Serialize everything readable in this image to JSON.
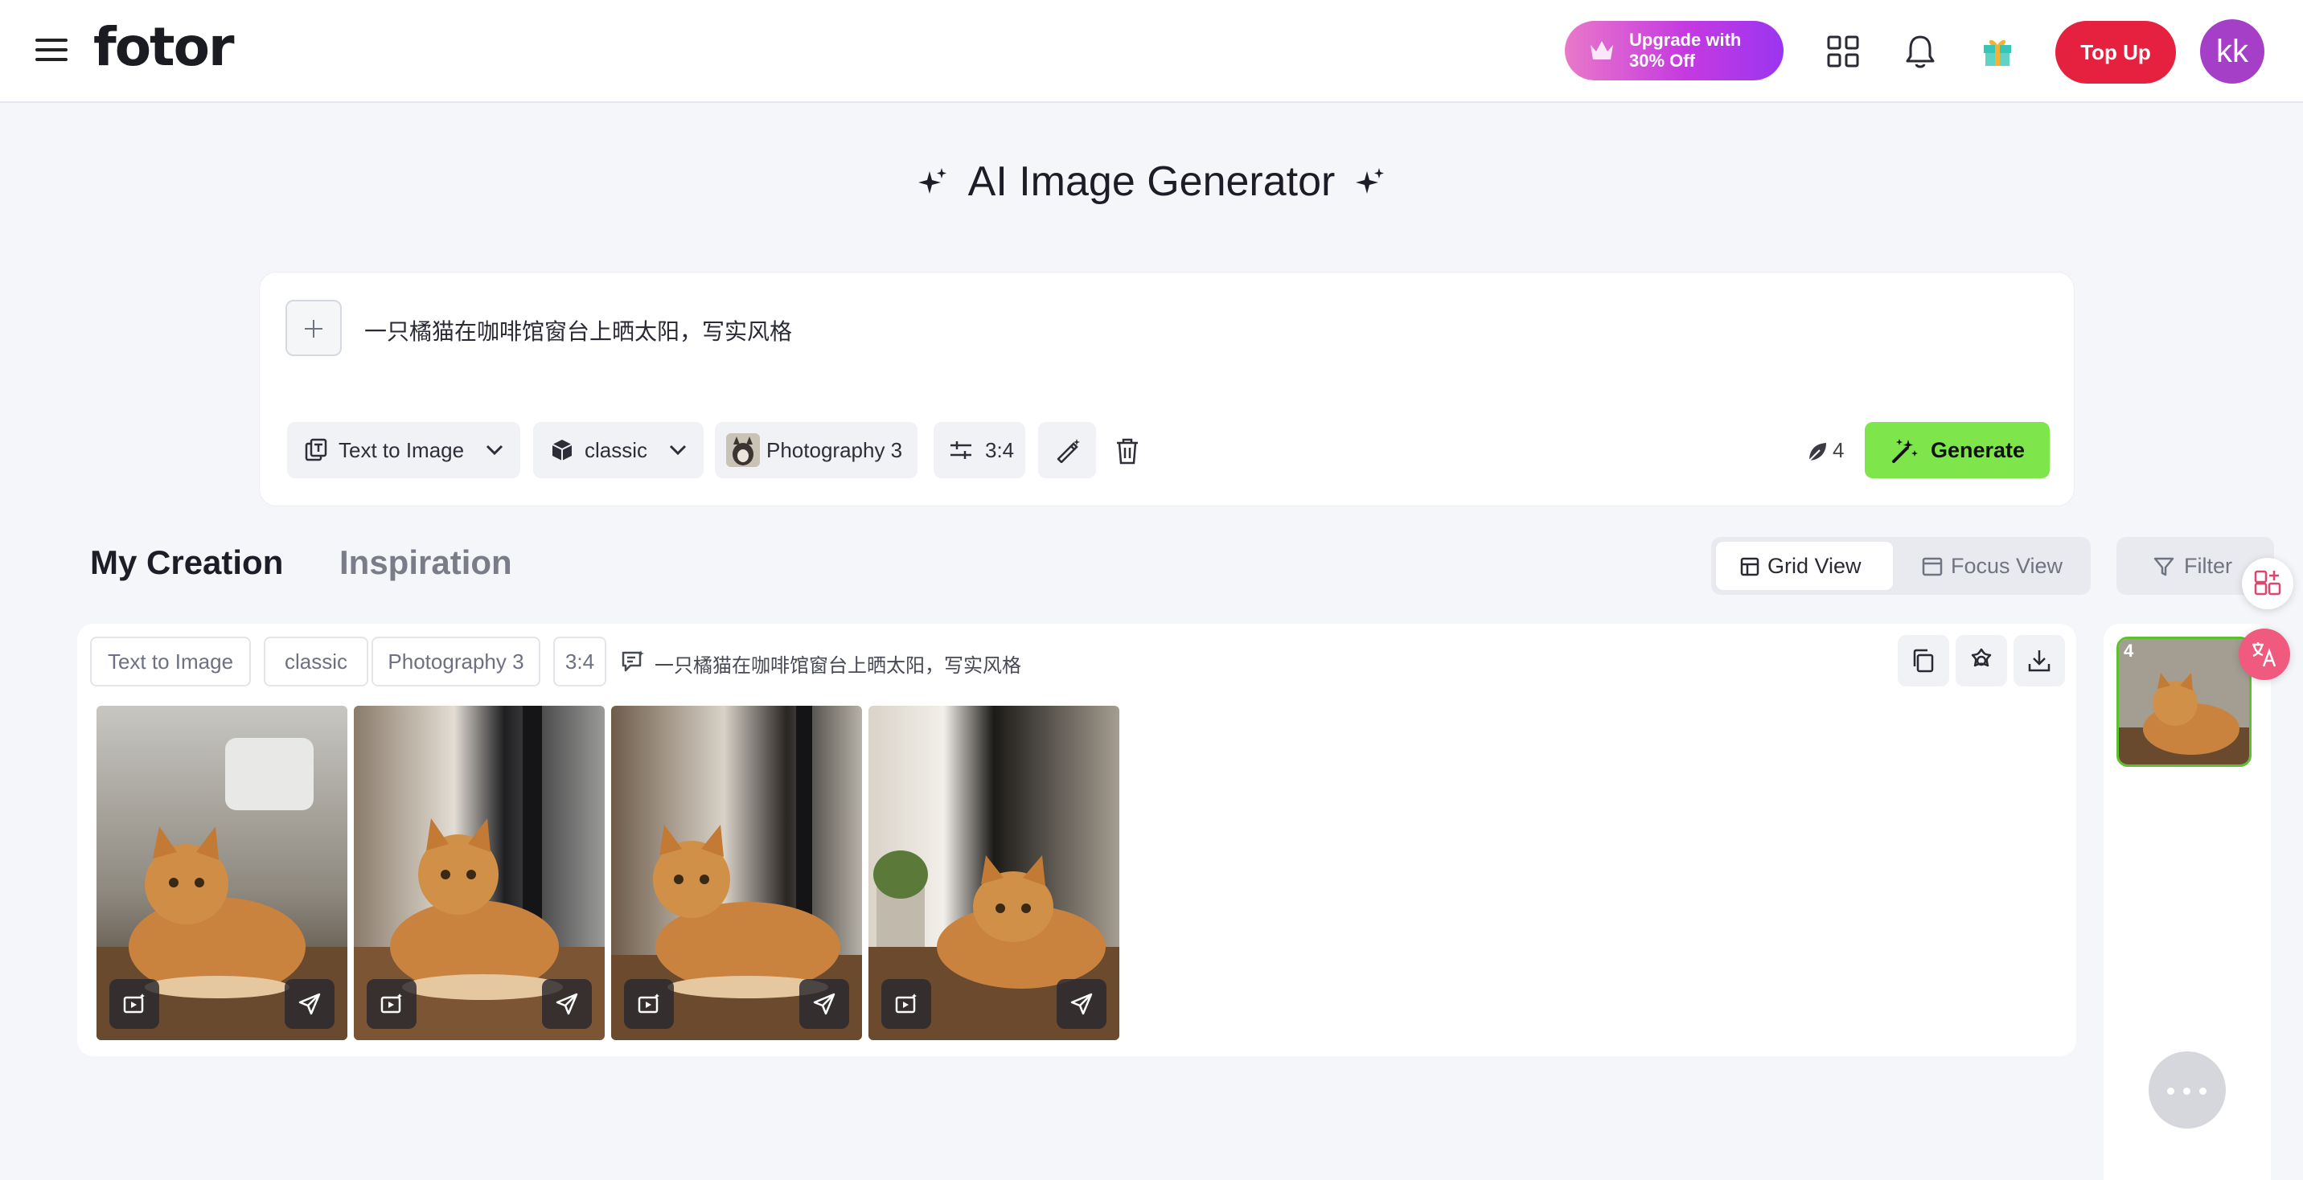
{
  "header": {
    "logo": "fotor",
    "upgrade_line1": "Upgrade with",
    "upgrade_line2": "30% Off",
    "topup_label": "Top Up",
    "avatar_initials": "kk",
    "icons": [
      "menu-icon",
      "apps-grid-icon",
      "bell-icon",
      "gift-icon"
    ]
  },
  "page_title": "AI Image Generator",
  "prompt": {
    "text": "一只橘猫在咖啡馆窗台上晒太阳，写实风格",
    "mode_label": "Text to Image",
    "model_label": "classic",
    "style_label": "Photography 3",
    "ratio_label": "3:4",
    "credits": "4",
    "generate_label": "Generate"
  },
  "tabs": {
    "my_creation": "My Creation",
    "inspiration": "Inspiration"
  },
  "view": {
    "grid_label": "Grid View",
    "focus_label": "Focus View",
    "filter_label": "Filter"
  },
  "result": {
    "tags": [
      "Text to Image",
      "classic",
      "Photography 3",
      "3:4"
    ],
    "prompt_text": "一只橘猫在咖啡馆窗台上晒太阳，写实风格"
  },
  "history": {
    "count": "4"
  },
  "colors": {
    "accent_green": "#7ee64a",
    "topup_red": "#e5213f",
    "avatar_purple": "#a63fc8",
    "upgrade_gradient_start": "#e879c9",
    "upgrade_gradient_end": "#9b35f0"
  }
}
